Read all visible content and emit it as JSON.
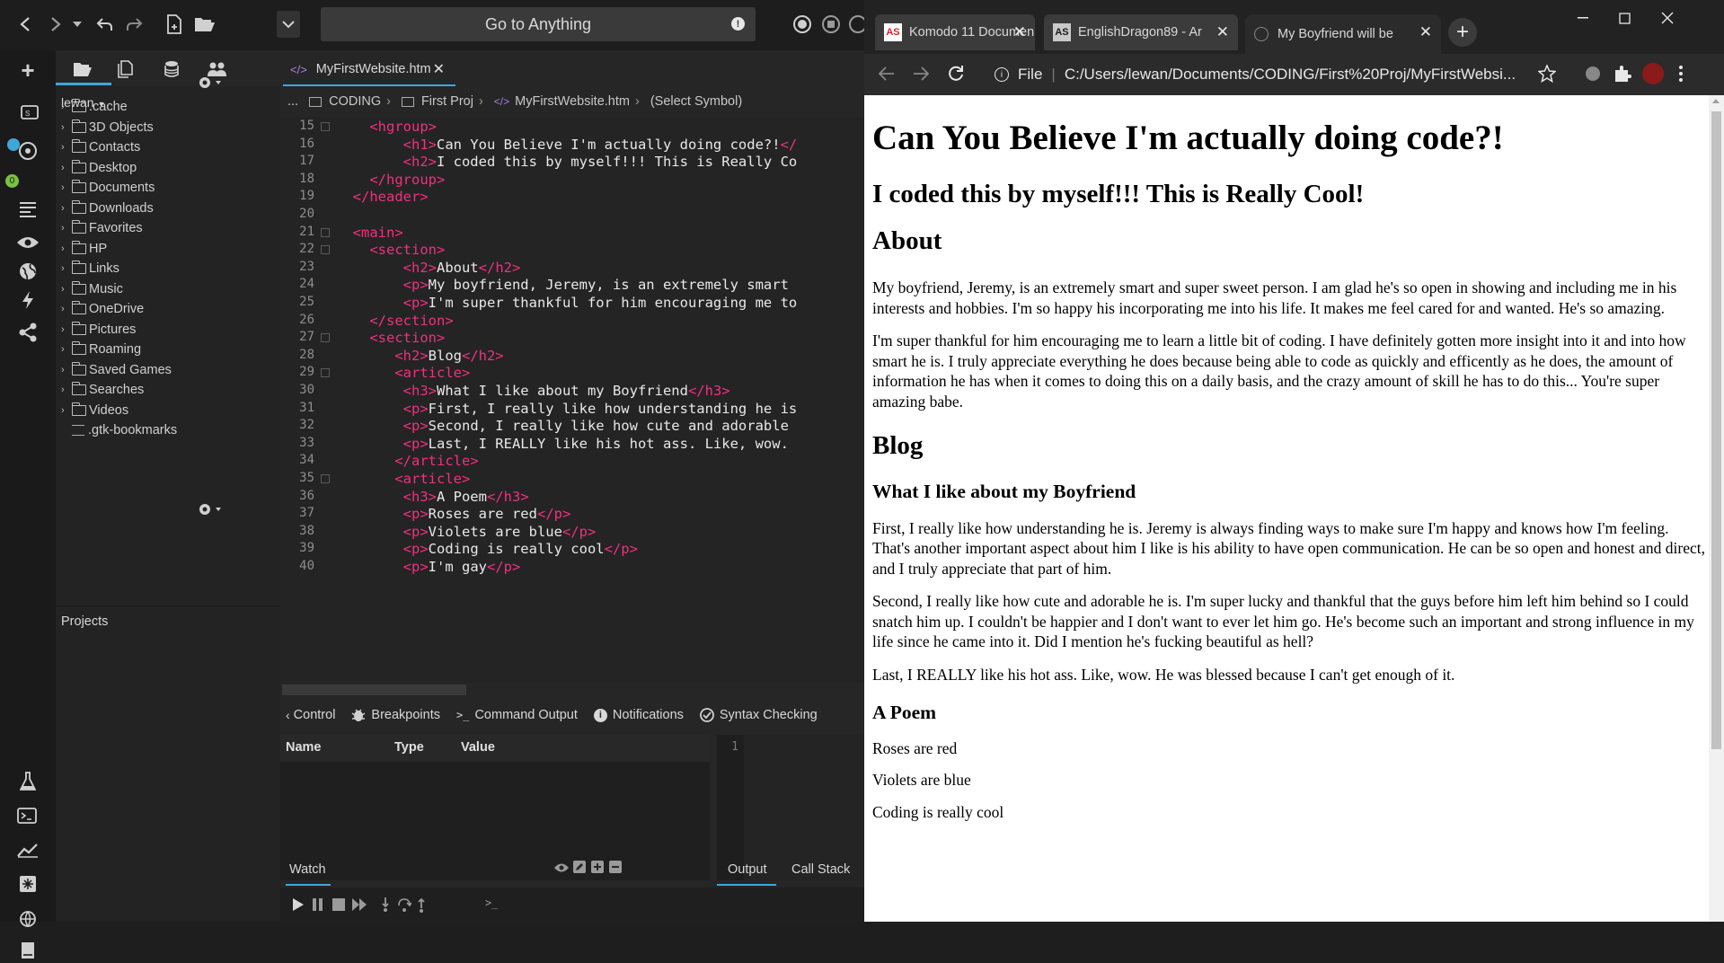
{
  "komodo": {
    "goto_label": "Go to Anything",
    "user_label": "lewan",
    "projects_label": "Projects",
    "file_tree": [
      ".cache",
      "3D Objects",
      "Contacts",
      "Desktop",
      "Documents",
      "Downloads",
      "Favorites",
      "HP",
      "Links",
      "Music",
      "OneDrive",
      "Pictures",
      "Roaming",
      "Saved Games",
      "Searches",
      "Videos",
      ".gtk-bookmarks"
    ],
    "editor_tab": "MyFirstWebsite.htm",
    "breadcrumb": [
      "...",
      "CODING",
      "First Proj",
      "MyFirstWebsite.htm",
      "(Select Symbol)"
    ],
    "code_lines": [
      {
        "n": "15",
        "indent": "    ",
        "html": [
          [
            "tag",
            "<hgroup>"
          ]
        ]
      },
      {
        "n": "16",
        "indent": "        ",
        "html": [
          [
            "tag",
            "<h1>"
          ],
          [
            "txt",
            "Can You Believe I'm actually doing code?!"
          ],
          [
            "tag",
            "</"
          ]
        ]
      },
      {
        "n": "17",
        "indent": "        ",
        "html": [
          [
            "tag",
            "<h2>"
          ],
          [
            "txt",
            "I coded this by myself!!! This is Really Co"
          ]
        ]
      },
      {
        "n": "18",
        "indent": "    ",
        "html": [
          [
            "tag",
            "</hgroup>"
          ]
        ]
      },
      {
        "n": "19",
        "indent": "  ",
        "html": [
          [
            "tag",
            "</header>"
          ]
        ]
      },
      {
        "n": "20",
        "indent": "",
        "html": []
      },
      {
        "n": "21",
        "indent": "  ",
        "html": [
          [
            "tag",
            "<main>"
          ]
        ]
      },
      {
        "n": "22",
        "indent": "    ",
        "html": [
          [
            "tag",
            "<section>"
          ]
        ]
      },
      {
        "n": "23",
        "indent": "        ",
        "html": [
          [
            "tag",
            "<h2>"
          ],
          [
            "txt",
            "About"
          ],
          [
            "tag",
            "</h2>"
          ]
        ]
      },
      {
        "n": "24",
        "indent": "        ",
        "html": [
          [
            "tag",
            "<p>"
          ],
          [
            "txt",
            "My boyfriend, Jeremy, is an extremely smart "
          ]
        ]
      },
      {
        "n": "25",
        "indent": "        ",
        "html": [
          [
            "tag",
            "<p>"
          ],
          [
            "txt",
            "I'm super thankful for him encouraging me to"
          ]
        ]
      },
      {
        "n": "26",
        "indent": "    ",
        "html": [
          [
            "tag",
            "</section>"
          ]
        ]
      },
      {
        "n": "27",
        "indent": "    ",
        "html": [
          [
            "tag",
            "<section>"
          ]
        ]
      },
      {
        "n": "28",
        "indent": "       ",
        "html": [
          [
            "tag",
            "<h2>"
          ],
          [
            "txt",
            "Blog"
          ],
          [
            "tag",
            "</h2>"
          ]
        ]
      },
      {
        "n": "29",
        "indent": "       ",
        "html": [
          [
            "tag",
            "<article>"
          ]
        ]
      },
      {
        "n": "30",
        "indent": "        ",
        "html": [
          [
            "tag",
            "<h3>"
          ],
          [
            "txt",
            "What I like about my Boyfriend"
          ],
          [
            "tag",
            "</h3>"
          ]
        ]
      },
      {
        "n": "31",
        "indent": "        ",
        "html": [
          [
            "tag",
            "<p>"
          ],
          [
            "txt",
            "First, I really like how understanding he is"
          ]
        ]
      },
      {
        "n": "32",
        "indent": "        ",
        "html": [
          [
            "tag",
            "<p>"
          ],
          [
            "txt",
            "Second, I really like how cute and adorable "
          ]
        ]
      },
      {
        "n": "33",
        "indent": "        ",
        "html": [
          [
            "tag",
            "<p>"
          ],
          [
            "txt",
            "Last, I REALLY like his hot ass. Like, wow. "
          ]
        ]
      },
      {
        "n": "34",
        "indent": "       ",
        "html": [
          [
            "tag",
            "</article>"
          ]
        ]
      },
      {
        "n": "35",
        "indent": "       ",
        "html": [
          [
            "tag",
            "<article>"
          ]
        ]
      },
      {
        "n": "36",
        "indent": "        ",
        "html": [
          [
            "tag",
            "<h3>"
          ],
          [
            "txt",
            "A Poem"
          ],
          [
            "tag",
            "</h3>"
          ]
        ]
      },
      {
        "n": "37",
        "indent": "        ",
        "html": [
          [
            "tag",
            "<p>"
          ],
          [
            "txt",
            "Roses are red"
          ],
          [
            "tag",
            "</p>"
          ]
        ]
      },
      {
        "n": "38",
        "indent": "        ",
        "html": [
          [
            "tag",
            "<p>"
          ],
          [
            "txt",
            "Violets are blue"
          ],
          [
            "tag",
            "</p>"
          ]
        ]
      },
      {
        "n": "39",
        "indent": "        ",
        "html": [
          [
            "tag",
            "<p>"
          ],
          [
            "txt",
            "Coding is really cool"
          ],
          [
            "tag",
            "</p>"
          ]
        ]
      },
      {
        "n": "40",
        "indent": "        ",
        "html": [
          [
            "tag",
            "<p>"
          ],
          [
            "txt",
            "I'm gay"
          ],
          [
            "tag",
            "</p>"
          ]
        ]
      }
    ],
    "bottom_tabs": [
      "Control",
      "Breakpoints",
      "Command Output",
      "Notifications",
      "Syntax Checking"
    ],
    "var_headers": [
      "Name",
      "Type",
      "Value"
    ],
    "output_line": "1",
    "watch_label": "Watch",
    "output_tabs": [
      "Output",
      "Call Stack"
    ],
    "console_prompt": ">_"
  },
  "chrome": {
    "tabs": [
      {
        "title": "Komodo 11 Documen",
        "icon": "AS"
      },
      {
        "title": "EnglishDragon89 - Ar",
        "icon": "AS"
      },
      {
        "title": "My Boyfriend will be",
        "icon": "globe"
      }
    ],
    "scheme_label": "File",
    "url": "C:/Users/lewan/Documents/CODING/First%20Proj/MyFirstWebsi..."
  },
  "page": {
    "h1": "Can You Believe I'm actually doing code?!",
    "h2": "I coded this by myself!!! This is Really Cool!",
    "about_heading": "About",
    "about_p1": "My boyfriend, Jeremy, is an extremely smart and super sweet person. I am glad he's so open in showing and including me in his interests and hobbies. I'm so happy his incorporating me into his life. It makes me feel cared for and wanted. He's so amazing.",
    "about_p2": "I'm super thankful for him encouraging me to learn a little bit of coding. I have definitely gotten more insight into it and into how smart he is. I truly appreciate everything he does because being able to code as quickly and efficently as he does, the amount of information he has when it comes to doing this on a daily basis, and the crazy amount of skill he has to do this... You're super amazing babe.",
    "blog_heading": "Blog",
    "article1_heading": "What I like about my Boyfriend",
    "article1_p1": "First, I really like how understanding he is. Jeremy is always finding ways to make sure I'm happy and knows how I'm feeling. That's another important aspect about him I like is his ability to have open communication. He can be so open and honest and direct, and I truly appreciate that part of him.",
    "article1_p2": "Second, I really like how cute and adorable he is. I'm super lucky and thankful that the guys before him left him behind so I could snatch him up. I couldn't be happier and I don't want to ever let him go. He's become such an important and strong influence in my life since he came into it. Did I mention he's fucking beautiful as hell?",
    "article1_p3": "Last, I REALLY like his hot ass. Like, wow. He was blessed because I can't get enough of it.",
    "poem_heading": "A Poem",
    "poem_l1": "Roses are red",
    "poem_l2": "Violets are blue",
    "poem_l3": "Coding is really cool"
  },
  "colors": {
    "accent": "#3ea7d8",
    "tag": "#f0307f",
    "badge_green": "#7bc043"
  }
}
